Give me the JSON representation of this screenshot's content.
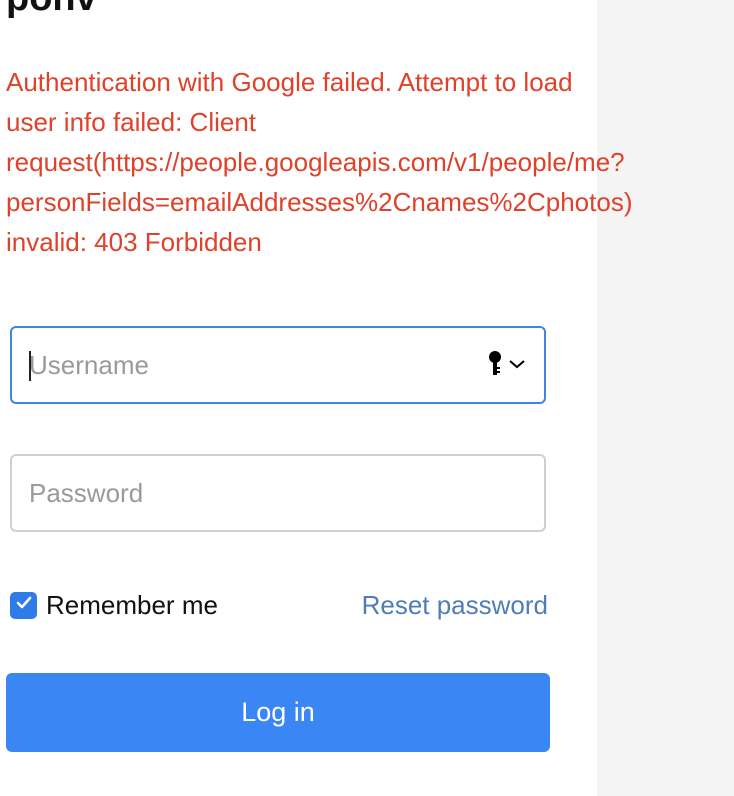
{
  "app": {
    "title": "ponv"
  },
  "error": {
    "lines": [
      "Authentication with Google failed. Attempt to load",
      "user info failed: Client",
      "request(https://people.googleapis.com/v1/people/me?",
      "personFields=emailAddresses%2Cnames%2Cphotos)",
      "invalid: 403 Forbidden"
    ],
    "color": "#e0412b"
  },
  "form": {
    "username": {
      "placeholder": "Username",
      "value": ""
    },
    "password": {
      "placeholder": "Password",
      "value": ""
    },
    "remember": {
      "label": "Remember me",
      "checked": true
    },
    "reset_label": "Reset password",
    "submit_label": "Log in"
  },
  "icons": {
    "password_manager": "key-icon",
    "dropdown": "chevron-down-icon",
    "checkbox": "checkmark-icon"
  },
  "colors": {
    "accent": "#3a86f4",
    "focus_border": "#3f86e0",
    "link": "#4f7db9",
    "side_panel": "#f4f4f4"
  }
}
